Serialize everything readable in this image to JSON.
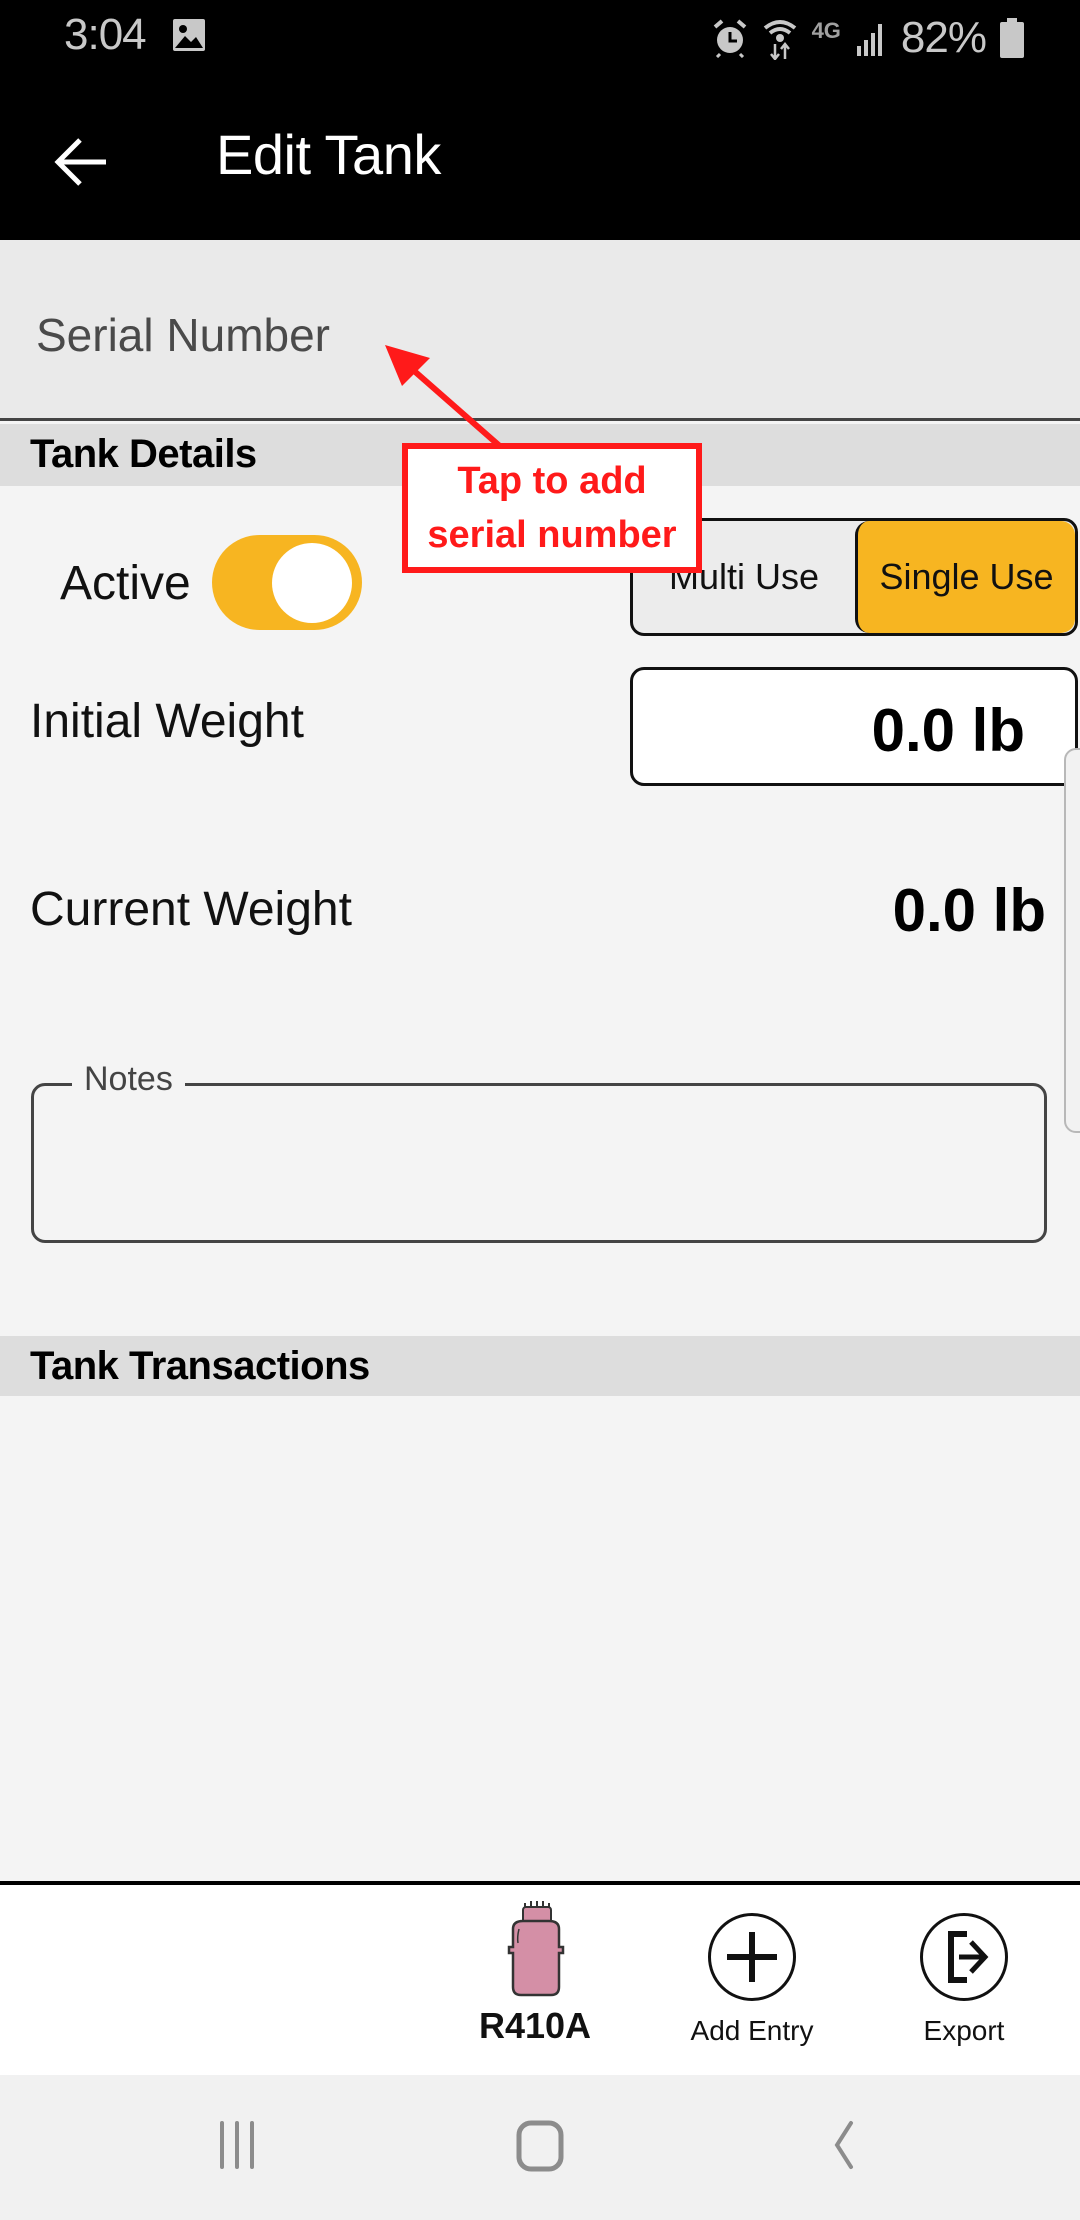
{
  "status_bar": {
    "time": "3:04",
    "left_icons": [
      "gallery-icon"
    ],
    "right_icons": [
      "alarm-icon",
      "wifi-data-icon",
      "4g-lte-icon",
      "signal-icon"
    ],
    "network": "4G",
    "battery_percent": "82%"
  },
  "toolbar": {
    "back_icon": "arrow-left-icon",
    "title": "Edit Tank"
  },
  "serial_number": {
    "placeholder": "Serial Number",
    "value": ""
  },
  "sections": {
    "tank_details": "Tank Details",
    "tank_transactions": "Tank Transactions"
  },
  "details": {
    "active_label": "Active",
    "active_on": true,
    "usage_options": [
      "Multi Use",
      "Single Use"
    ],
    "usage_selected": "Single Use",
    "initial_weight_label": "Initial Weight",
    "initial_weight_value": "0.0 lb",
    "current_weight_label": "Current Weight",
    "current_weight_value": "0.0 lb",
    "notes_label": "Notes",
    "notes_value": ""
  },
  "colors": {
    "accent": "#f7b521",
    "annotation": "#ff1a1a",
    "refrigerant_tank": "#d48fa6"
  },
  "bottom_bar": {
    "refrigerant": {
      "label": "R410A",
      "icon": "refrigerant-tank-icon"
    },
    "add_entry": {
      "label": "Add Entry",
      "icon": "plus-circle-icon"
    },
    "export": {
      "label": "Export",
      "icon": "export-icon"
    }
  },
  "nav_bar": {
    "buttons": [
      "recents-icon",
      "home-icon",
      "back-icon"
    ]
  },
  "annotation": {
    "text": "Tap to add\nserial number"
  }
}
